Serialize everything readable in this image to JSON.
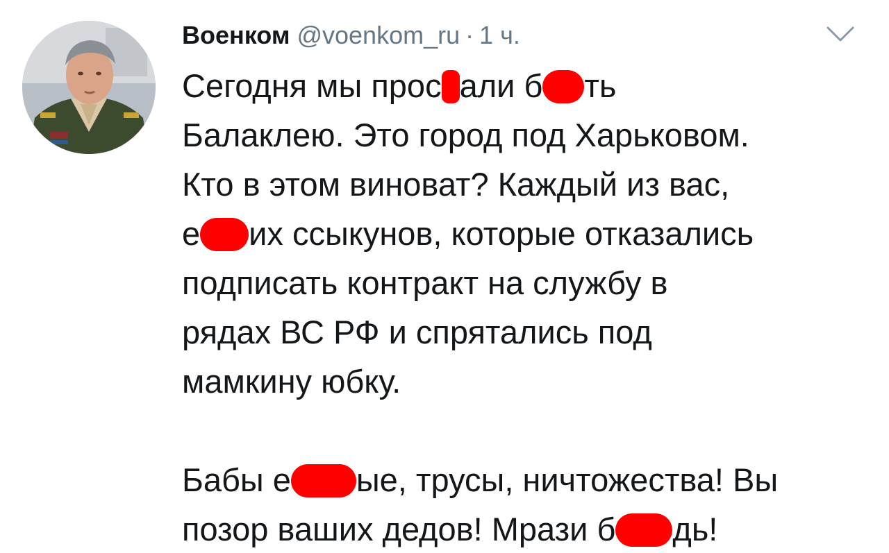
{
  "tweet": {
    "display_name": "Военком",
    "handle": "@voenkom_ru",
    "separator": "·",
    "time": "1 ч.",
    "avatar_icon": "user-avatar-photo",
    "menu_icon": "chevron-down-icon",
    "redaction_color": "#ff0000",
    "paragraph1": {
      "l1_a": "Сегодня мы прос",
      "l1_b": "али б",
      "l1_c": "ть",
      "l2": "Балаклею. Это город под Харьковом.",
      "l3": "Кто в этом виноват? Каждый из вас,",
      "l4_a": "е",
      "l4_b": "их ссыкунов, которые отказались",
      "l5": "подписать контракт на службу в",
      "l6": "рядах ВС РФ и спрятались под",
      "l7": "мамкину юбку."
    },
    "paragraph2": {
      "l1_a": "Бабы е",
      "l1_b": "ые, трусы, ничтожества! Вы",
      "l2_a": "позор ваших дедов! Мрази б",
      "l2_b": "дь!"
    }
  }
}
